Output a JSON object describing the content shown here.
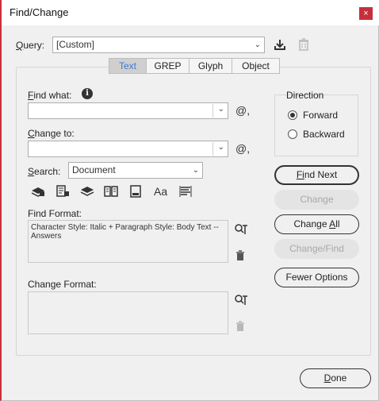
{
  "window": {
    "title": "Find/Change",
    "close": "×"
  },
  "query": {
    "label_u": "Q",
    "label_rest": "uery:",
    "value": "[Custom]"
  },
  "tabs": [
    {
      "label": "Text"
    },
    {
      "label": "GREP"
    },
    {
      "label": "Glyph"
    },
    {
      "label": "Object"
    }
  ],
  "find": {
    "label_u": "F",
    "label_rest": "ind what:",
    "info": "i",
    "value": "",
    "at": "@,"
  },
  "change": {
    "label_u": "C",
    "label_rest": "hange to:",
    "value": "",
    "at": "@,"
  },
  "search": {
    "label_u": "S",
    "label_rest": "earch:",
    "value": "Document"
  },
  "find_format": {
    "label": "Find Format:",
    "text": "Character Style: Italic + Paragraph Style: Body Text -- Answers"
  },
  "change_format": {
    "label": "Change Format:",
    "text": ""
  },
  "direction": {
    "label": "Direction",
    "forward": "Forward",
    "backward": "Backward",
    "selected": "Forward"
  },
  "buttons": {
    "find_next_u": "Fi",
    "find_next_rest": "nd Next",
    "change": "Change",
    "change_all_pre": "Change ",
    "change_all_u": "A",
    "change_all_rest": "ll",
    "change_find": "Change/Find",
    "fewer": "Fewer Options",
    "done_u": "D",
    "done_rest": "one"
  },
  "colors": {
    "accent": "#c8303a",
    "active_tab_text": "#3b7bd1"
  }
}
